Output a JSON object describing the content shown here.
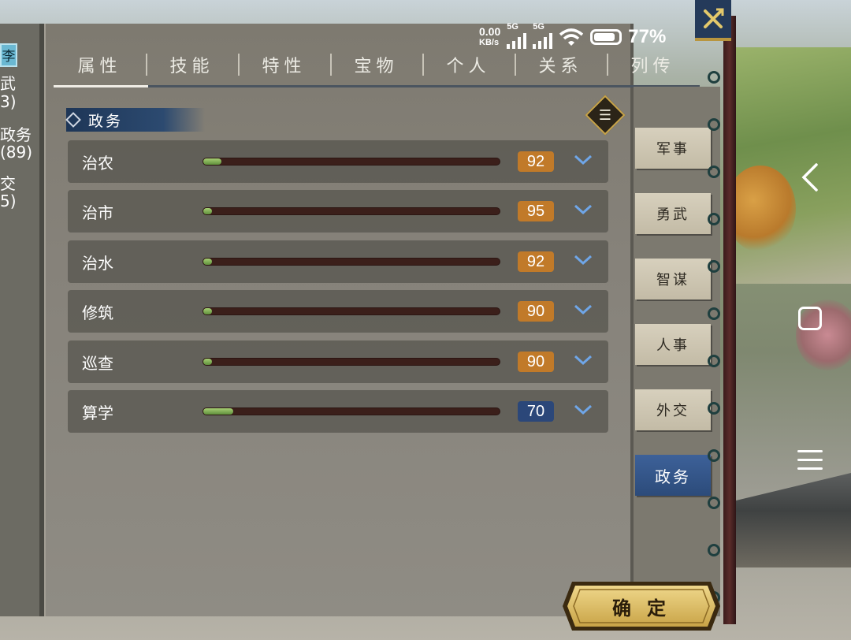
{
  "status_bar": {
    "net_speed": "0.00",
    "net_unit": "KB/s",
    "sim1": "5G",
    "sim2": "5G",
    "battery": "77%"
  },
  "left_panel": {
    "badge": "李",
    "stats": [
      {
        "name": "武",
        "value": "3)"
      },
      {
        "name": "政务",
        "value": "(89)"
      },
      {
        "name": "交",
        "value": "5)"
      }
    ]
  },
  "tabs": [
    {
      "label": "属性",
      "active": true
    },
    {
      "label": "技能",
      "active": false
    },
    {
      "label": "特性",
      "active": false
    },
    {
      "label": "宝物",
      "active": false
    },
    {
      "label": "个人",
      "active": false
    },
    {
      "label": "关系",
      "active": false
    },
    {
      "label": "列传",
      "active": false
    }
  ],
  "section": {
    "title": "政务",
    "list_icon": "list-icon"
  },
  "attributes": [
    {
      "name": "治农",
      "value": "92",
      "fill_fraction": 0.06,
      "badge_color": "#c17a29"
    },
    {
      "name": "治市",
      "value": "95",
      "fill_fraction": 0.03,
      "badge_color": "#c17a29"
    },
    {
      "name": "治水",
      "value": "92",
      "fill_fraction": 0.03,
      "badge_color": "#c17a29"
    },
    {
      "name": "修筑",
      "value": "90",
      "fill_fraction": 0.03,
      "badge_color": "#c17a29"
    },
    {
      "name": "巡查",
      "value": "90",
      "fill_fraction": 0.03,
      "badge_color": "#c17a29"
    },
    {
      "name": "算学",
      "value": "70",
      "fill_fraction": 0.1,
      "badge_color": "#2b4779"
    }
  ],
  "categories": [
    {
      "label": "军事",
      "active": false
    },
    {
      "label": "勇武",
      "active": false
    },
    {
      "label": "智谋",
      "active": false
    },
    {
      "label": "人事",
      "active": false
    },
    {
      "label": "外交",
      "active": false
    },
    {
      "label": "政务",
      "active": true
    }
  ],
  "confirm_button": {
    "label": "确定"
  },
  "colors": {
    "accent_blue": "#2c4b7a",
    "value_orange": "#c17a29",
    "bar_green": "#7fb056",
    "gold": "#d9b85c"
  }
}
